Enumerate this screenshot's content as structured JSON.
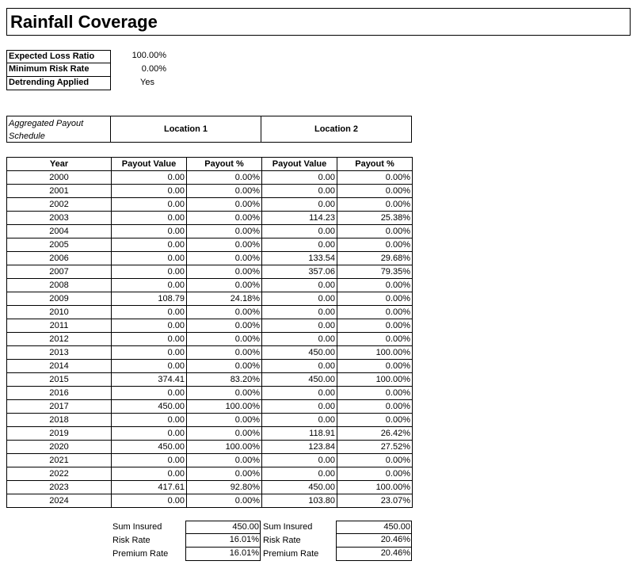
{
  "title": "Rainfall Coverage",
  "params": [
    {
      "label": "Expected Loss Ratio",
      "value": "100.00%"
    },
    {
      "label": "Minimum Risk Rate",
      "value": "0.00%"
    },
    {
      "label": "Detrending Applied",
      "value": "Yes"
    }
  ],
  "schedule_label": "Aggregated Payout Schedule",
  "locations": [
    "Location 1",
    "Location 2"
  ],
  "columns": [
    "Year",
    "Payout Value",
    "Payout %",
    "Payout Value",
    "Payout %"
  ],
  "rows": [
    [
      "2000",
      "0.00",
      "0.00%",
      "0.00",
      "0.00%"
    ],
    [
      "2001",
      "0.00",
      "0.00%",
      "0.00",
      "0.00%"
    ],
    [
      "2002",
      "0.00",
      "0.00%",
      "0.00",
      "0.00%"
    ],
    [
      "2003",
      "0.00",
      "0.00%",
      "114.23",
      "25.38%"
    ],
    [
      "2004",
      "0.00",
      "0.00%",
      "0.00",
      "0.00%"
    ],
    [
      "2005",
      "0.00",
      "0.00%",
      "0.00",
      "0.00%"
    ],
    [
      "2006",
      "0.00",
      "0.00%",
      "133.54",
      "29.68%"
    ],
    [
      "2007",
      "0.00",
      "0.00%",
      "357.06",
      "79.35%"
    ],
    [
      "2008",
      "0.00",
      "0.00%",
      "0.00",
      "0.00%"
    ],
    [
      "2009",
      "108.79",
      "24.18%",
      "0.00",
      "0.00%"
    ],
    [
      "2010",
      "0.00",
      "0.00%",
      "0.00",
      "0.00%"
    ],
    [
      "2011",
      "0.00",
      "0.00%",
      "0.00",
      "0.00%"
    ],
    [
      "2012",
      "0.00",
      "0.00%",
      "0.00",
      "0.00%"
    ],
    [
      "2013",
      "0.00",
      "0.00%",
      "450.00",
      "100.00%"
    ],
    [
      "2014",
      "0.00",
      "0.00%",
      "0.00",
      "0.00%"
    ],
    [
      "2015",
      "374.41",
      "83.20%",
      "450.00",
      "100.00%"
    ],
    [
      "2016",
      "0.00",
      "0.00%",
      "0.00",
      "0.00%"
    ],
    [
      "2017",
      "450.00",
      "100.00%",
      "0.00",
      "0.00%"
    ],
    [
      "2018",
      "0.00",
      "0.00%",
      "0.00",
      "0.00%"
    ],
    [
      "2019",
      "0.00",
      "0.00%",
      "118.91",
      "26.42%"
    ],
    [
      "2020",
      "450.00",
      "100.00%",
      "123.84",
      "27.52%"
    ],
    [
      "2021",
      "0.00",
      "0.00%",
      "0.00",
      "0.00%"
    ],
    [
      "2022",
      "0.00",
      "0.00%",
      "0.00",
      "0.00%"
    ],
    [
      "2023",
      "417.61",
      "92.80%",
      "450.00",
      "100.00%"
    ],
    [
      "2024",
      "0.00",
      "0.00%",
      "103.80",
      "23.07%"
    ]
  ],
  "summary": {
    "location1": [
      {
        "label": "Sum Insured",
        "value": "450.00"
      },
      {
        "label": "Risk Rate",
        "value": "16.01%"
      },
      {
        "label": "Premium Rate",
        "value": "16.01%"
      }
    ],
    "location2": [
      {
        "label": "Sum Insured",
        "value": "450.00"
      },
      {
        "label": "Risk Rate",
        "value": "20.46%"
      },
      {
        "label": "Premium Rate",
        "value": "20.46%"
      }
    ]
  }
}
